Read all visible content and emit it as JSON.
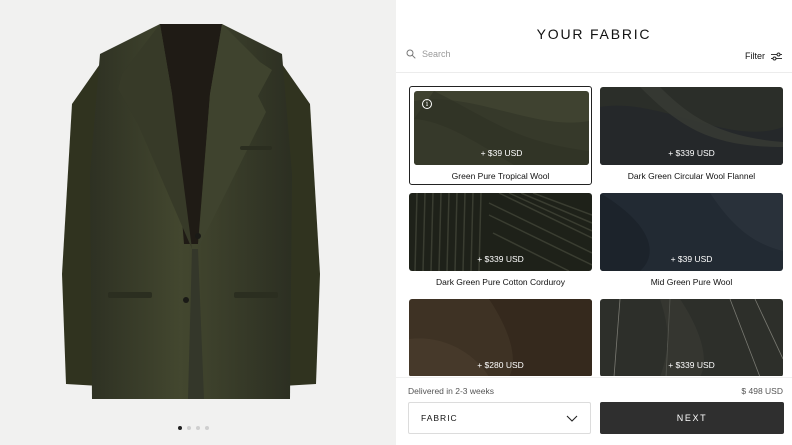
{
  "header": {
    "title": "YOUR FABRIC"
  },
  "search": {
    "placeholder": "Search"
  },
  "filter": {
    "label": "Filter"
  },
  "fabrics": [
    {
      "name": "Green Pure Tropical Wool",
      "price": "+ $39 USD",
      "selected": true,
      "color": "#3d3f2c"
    },
    {
      "name": "Dark Green Circular Wool Flannel",
      "price": "+ $339 USD",
      "selected": false,
      "color": "#2b2d28"
    },
    {
      "name": "Dark Green Pure Cotton Corduroy",
      "price": "+ $339 USD",
      "selected": false,
      "color": "#20231b"
    },
    {
      "name": "Mid Green Pure Wool",
      "price": "+ $39 USD",
      "selected": false,
      "color": "#232a32"
    },
    {
      "name": "",
      "price": "+ $280 USD",
      "selected": false,
      "color": "#3e3224"
    },
    {
      "name": "",
      "price": "+ $339 USD",
      "selected": false,
      "color": "#2d2f2a"
    }
  ],
  "footer": {
    "delivery": "Delivered in 2-3 weeks",
    "total": "$ 498 USD",
    "select_label": "FABRIC",
    "next_label": "NEXT"
  },
  "carousel": {
    "slides": 4,
    "active": 0
  },
  "colors": {
    "jacket": "#3c3f2e",
    "button_dark": "#2f2f2f"
  }
}
